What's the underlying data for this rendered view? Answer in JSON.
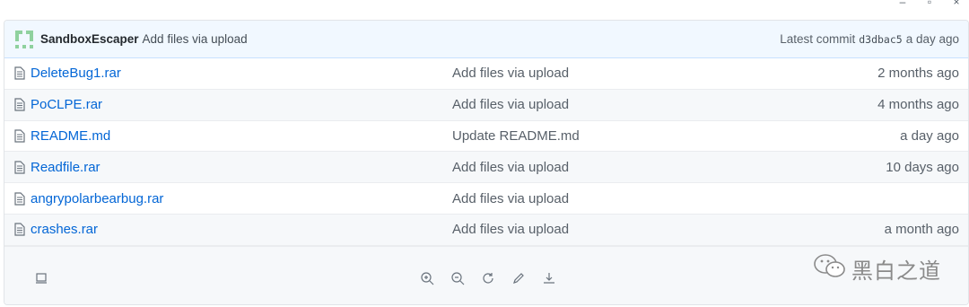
{
  "window": {
    "controls": [
      "–",
      "▫",
      "×"
    ]
  },
  "commit": {
    "author": "SandboxEscaper",
    "message": "Add files via upload",
    "latest_label": "Latest commit",
    "sha": "d3dbac5",
    "age": "a day ago"
  },
  "files": [
    {
      "name": "DeleteBug1.rar",
      "message": "Add files via upload",
      "age": "2 months ago"
    },
    {
      "name": "PoCLPE.rar",
      "message": "Add files via upload",
      "age": "4 months ago"
    },
    {
      "name": "README.md",
      "message": "Update README.md",
      "age": "a day ago"
    },
    {
      "name": "Readfile.rar",
      "message": "Add files via upload",
      "age": "10 days ago"
    },
    {
      "name": "angrypolarbearbug.rar",
      "message": "Add files via upload",
      "age": ""
    },
    {
      "name": "crashes.rar",
      "message": "Add files via upload",
      "age": "a month ago"
    }
  ],
  "viewer_toolbar": {
    "icons": [
      "screen-icon",
      "zoom-in-icon",
      "zoom-out-icon",
      "rotate-icon",
      "edit-icon",
      "download-icon"
    ]
  },
  "watermark": {
    "text": "黑白之道",
    "icon": "wechat-icon"
  },
  "colors": {
    "link": "#0366d6",
    "commit_bar_bg": "#f1f8ff",
    "avatar": "#8fd19e"
  }
}
